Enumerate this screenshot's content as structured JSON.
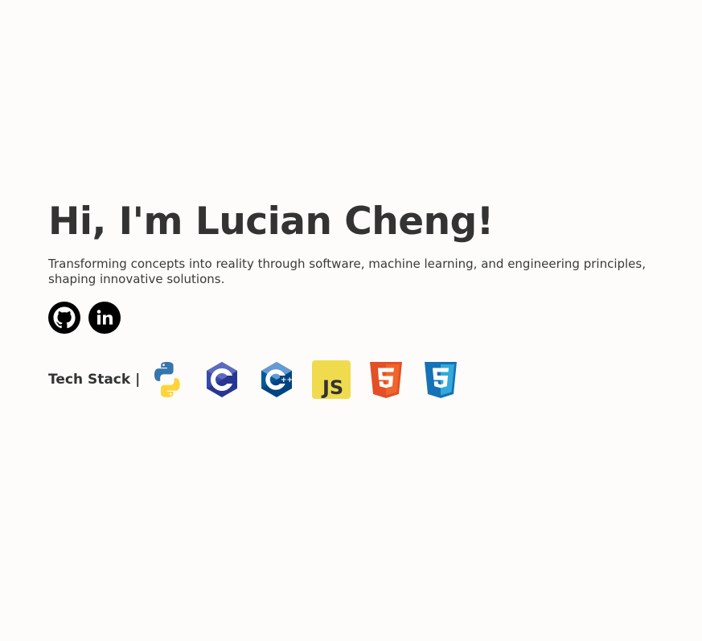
{
  "hero": {
    "title": "Hi, I'm Lucian Cheng!",
    "subtitle": "Transforming concepts into reality through software, machine learning, and engineering principles, shaping innovative solutions."
  },
  "socials": [
    {
      "icon": "github-icon"
    },
    {
      "icon": "linkedin-icon"
    }
  ],
  "tech_stack": {
    "label": "Tech Stack |",
    "icons": [
      "python-icon",
      "c-icon",
      "cpp-icon",
      "javascript-icon",
      "html5-icon",
      "css3-icon"
    ],
    "js_text": "JS",
    "cpp_plus": "++",
    "c_letter": "C"
  },
  "colors": {
    "background": "#fdfcfa",
    "text": "#333333",
    "python_blue": "#3776ab",
    "python_yellow": "#ffd43b",
    "c_blue": "#283593",
    "cpp_blue": "#00599c",
    "js_yellow": "#f0db4f",
    "html_orange": "#e34f26",
    "css_blue": "#1572b6"
  }
}
